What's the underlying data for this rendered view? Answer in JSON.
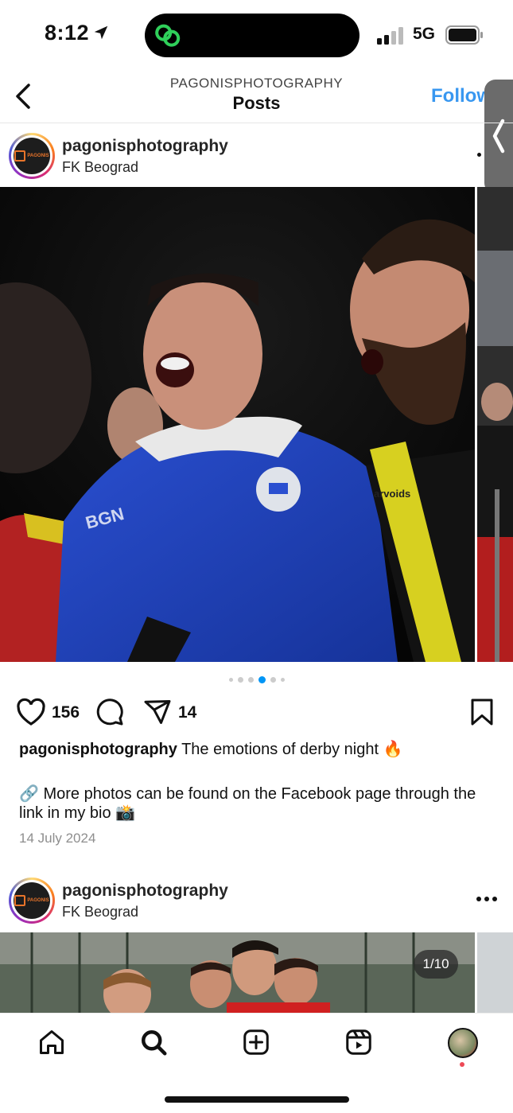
{
  "status_bar": {
    "time": "8:12",
    "network": "5G"
  },
  "header": {
    "username": "PAGONISPHOTOGRAPHY",
    "title": "Posts",
    "follow_label": "Follow"
  },
  "posts": [
    {
      "username": "pagonisphotography",
      "location": "FK Beograd",
      "likes": "156",
      "shares": "14",
      "caption_user": "pagonisphotography",
      "caption_text": "The emotions of derby night 🔥",
      "caption_more": "🔗 More photos can be found on the Facebook page through the link in my bio 📸",
      "date": "14 July 2024",
      "carousel": {
        "count": 6,
        "active": 3
      }
    },
    {
      "username": "pagonisphotography",
      "location": "FK Beograd",
      "page_badge": "1/10"
    }
  ],
  "avatar_logo_text": "PAGONIS",
  "colors": {
    "accent": "#0095f6",
    "follow": "#3897f0",
    "notification": "#ed4956"
  },
  "icons": [
    "back-chevron-icon",
    "heart-icon",
    "comment-icon",
    "share-icon",
    "bookmark-icon",
    "home-icon",
    "search-icon",
    "create-icon",
    "reels-icon"
  ]
}
